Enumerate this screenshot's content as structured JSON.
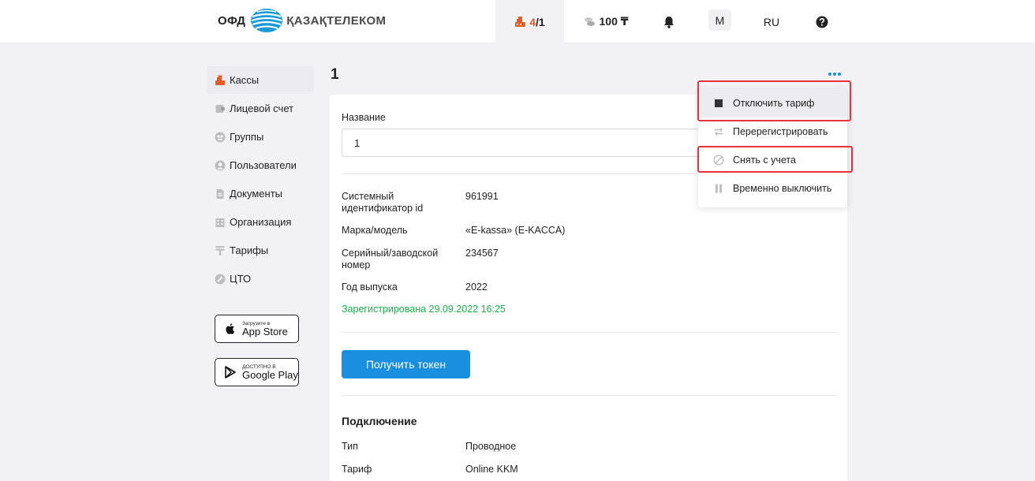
{
  "header": {
    "logo_left": "ОФД",
    "logo_right": "ҚАЗАҚТЕЛЕКОМ",
    "kassa_current": "4",
    "kassa_total": "/1",
    "balance": "100 ₸",
    "avatar": "M",
    "language": "RU"
  },
  "sidebar": {
    "items": [
      {
        "label": "Кассы",
        "icon": "cash-register-icon"
      },
      {
        "label": "Лицевой счет",
        "icon": "wallet-icon"
      },
      {
        "label": "Группы",
        "icon": "groups-icon"
      },
      {
        "label": "Пользователи",
        "icon": "user-icon"
      },
      {
        "label": "Документы",
        "icon": "document-icon"
      },
      {
        "label": "Организация",
        "icon": "building-icon"
      },
      {
        "label": "Тарифы",
        "icon": "tariff-icon"
      },
      {
        "label": "ЦТО",
        "icon": "service-icon"
      }
    ],
    "appstore_small": "Загрузите в",
    "appstore_big": "App Store",
    "gplay_small": "ДОСТУПНО В",
    "gplay_big": "Google Play"
  },
  "main": {
    "title": "1",
    "name_label": "Название",
    "name_value": "1",
    "fields": [
      {
        "label": "Системный идентификатор id",
        "value": "961991"
      },
      {
        "label": "Марка/модель",
        "value": "«E-kassa» (E-KACCA)"
      },
      {
        "label": "Серийный/заводской номер",
        "value": "234567"
      },
      {
        "label": "Год выпуска",
        "value": "2022"
      }
    ],
    "registered": "Зарегистрирована 29.09.2022 16:25",
    "token_button": "Получить токен",
    "connection_title": "Подключение",
    "connection": [
      {
        "label": "Тип",
        "value": "Проводное"
      },
      {
        "label": "Тариф",
        "value": "Online KKM"
      }
    ]
  },
  "dropdown": {
    "items": [
      {
        "label": "Отключить тариф",
        "icon": "stop-icon"
      },
      {
        "label": "Перерегистрировать",
        "icon": "reregister-icon"
      },
      {
        "label": "Снять с учета",
        "icon": "deregister-icon"
      },
      {
        "label": "Временно выключить",
        "icon": "pause-icon"
      }
    ]
  },
  "colors": {
    "accent": "#1a8fe0",
    "kassa_orange": "#e35d2b",
    "success": "#19b34a",
    "highlight_red": "#e8323c"
  }
}
